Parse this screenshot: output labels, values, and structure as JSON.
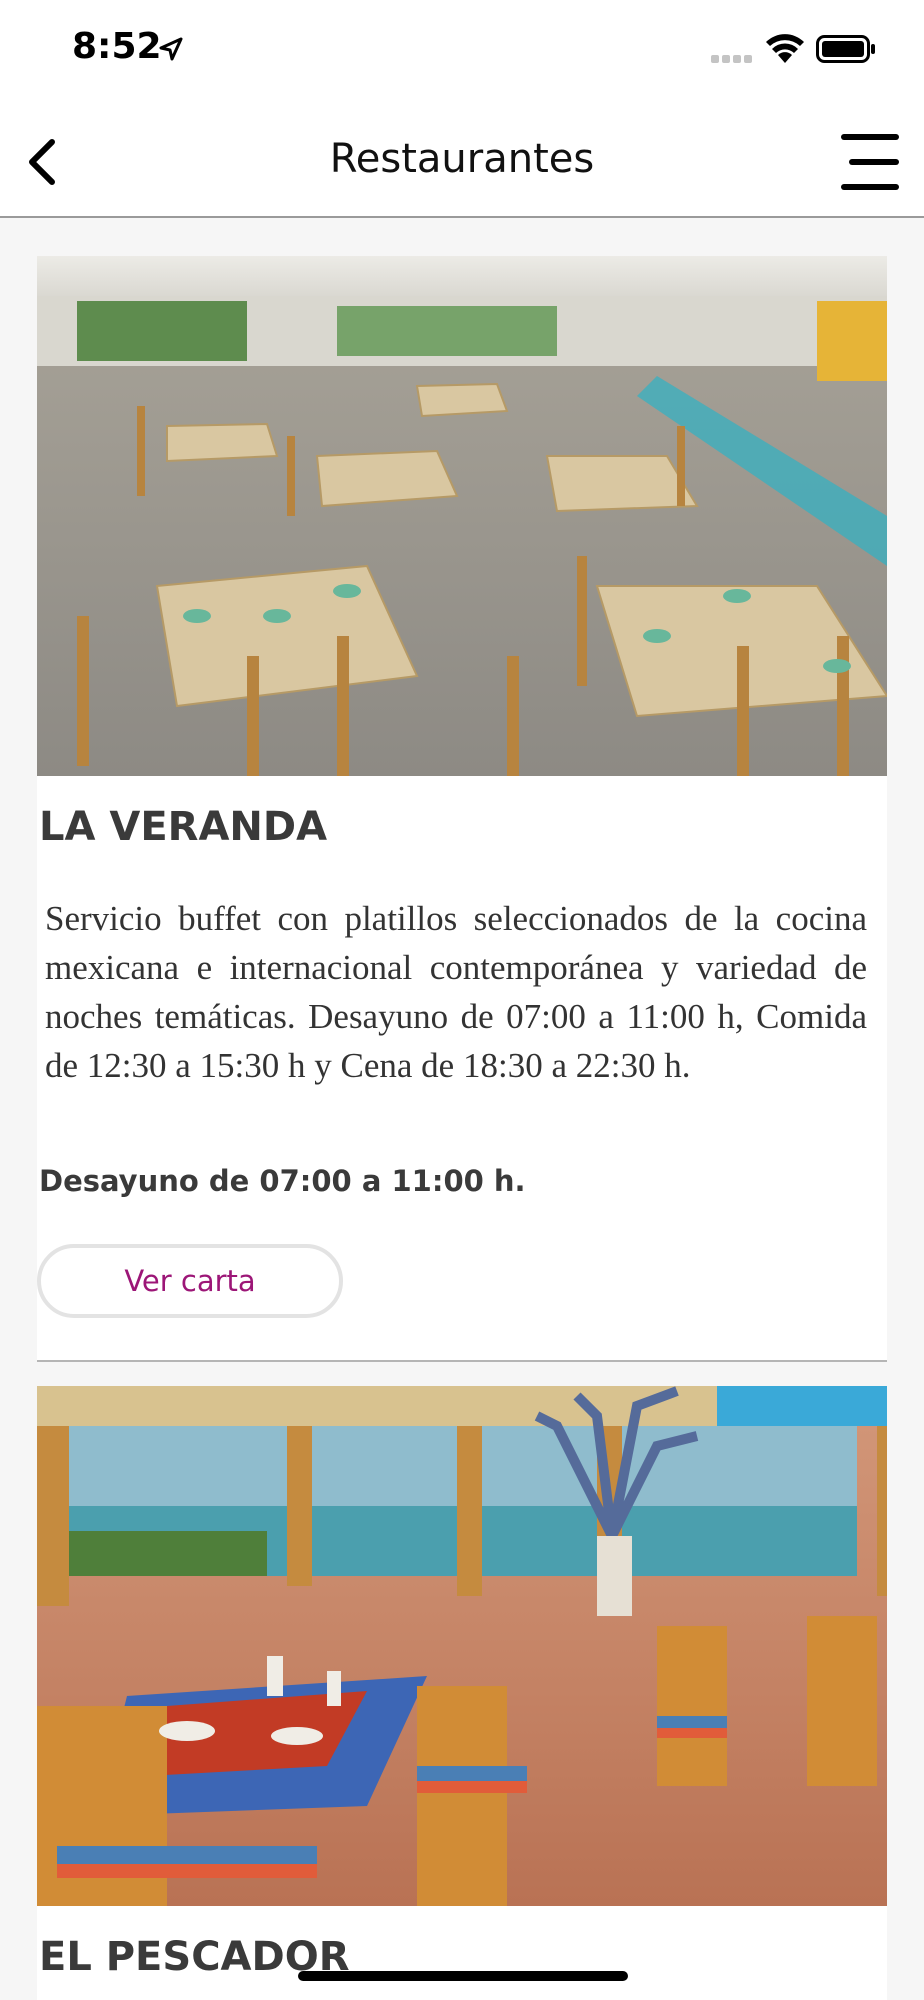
{
  "status_bar": {
    "time": "8:52"
  },
  "nav": {
    "title": "Restaurantes"
  },
  "restaurants": [
    {
      "name": "LA VERANDA",
      "description": "Servicio buffet con platillos seleccionados de la cocina mexicana e internacional contemporánea y variedad de noches temáticas. Desayuno de 07:00 a 11:00 h, Comida de 12:30 a 15:30 h y Cena de 18:30 a 22:30 h.",
      "hours": "Desayuno de 07:00 a 11:00 h.",
      "button_label": "Ver carta"
    },
    {
      "name": "EL PESCADOR"
    }
  ],
  "colors": {
    "accent": "#9c1677",
    "background": "#f6f6f6"
  },
  "icons": {
    "back": "chevron-left-icon",
    "menu": "hamburger-menu-icon",
    "location": "location-arrow-icon",
    "wifi": "wifi-icon",
    "battery": "battery-icon",
    "signal": "signal-icon"
  }
}
